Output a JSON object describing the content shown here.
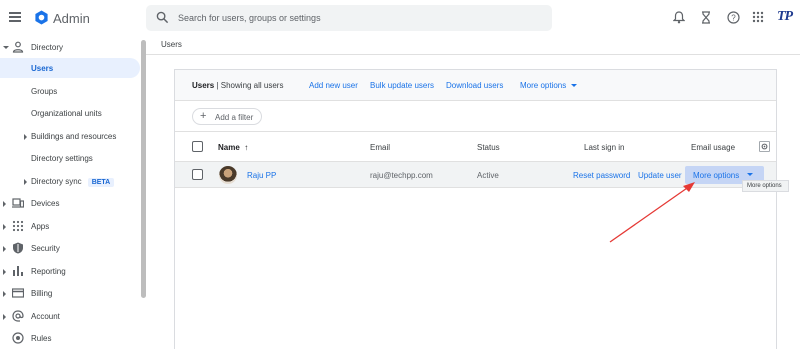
{
  "app": {
    "brand": "Admin",
    "watermark": "TP"
  },
  "search": {
    "placeholder": "Search for users, groups or settings"
  },
  "topbar_icons": [
    "bell-icon",
    "hourglass-icon",
    "help-icon",
    "apps-grid-icon"
  ],
  "sidebar": {
    "items": [
      {
        "label": "Directory"
      },
      {
        "label": "Users"
      },
      {
        "label": "Groups"
      },
      {
        "label": "Organizational units"
      },
      {
        "label": "Buildings and resources"
      },
      {
        "label": "Directory settings"
      },
      {
        "label": "Directory sync",
        "badge": "BETA"
      },
      {
        "label": "Devices"
      },
      {
        "label": "Apps"
      },
      {
        "label": "Security"
      },
      {
        "label": "Reporting"
      },
      {
        "label": "Billing"
      },
      {
        "label": "Account"
      },
      {
        "label": "Rules"
      }
    ]
  },
  "breadcrumb": "Users",
  "card": {
    "title_bold": "Users",
    "title_rest": " | Showing all users",
    "actions": [
      "Add new user",
      "Bulk update users",
      "Download users",
      "More options"
    ],
    "filter_label": "Add a filter"
  },
  "table": {
    "headers": {
      "name": "Name",
      "sort_arrow": "↑",
      "email": "Email",
      "status": "Status",
      "last_sign_in": "Last sign in",
      "email_usage": "Email usage"
    },
    "rows": [
      {
        "name": "Raju PP",
        "email": "raju@techpp.com",
        "status": "Active",
        "reset": "Reset password",
        "update": "Update user",
        "more": "More options"
      }
    ]
  },
  "tooltip": "More options",
  "colors": {
    "accent": "#1a73e8",
    "active_bg": "#e8f0fe",
    "annotation": "#e53935"
  }
}
